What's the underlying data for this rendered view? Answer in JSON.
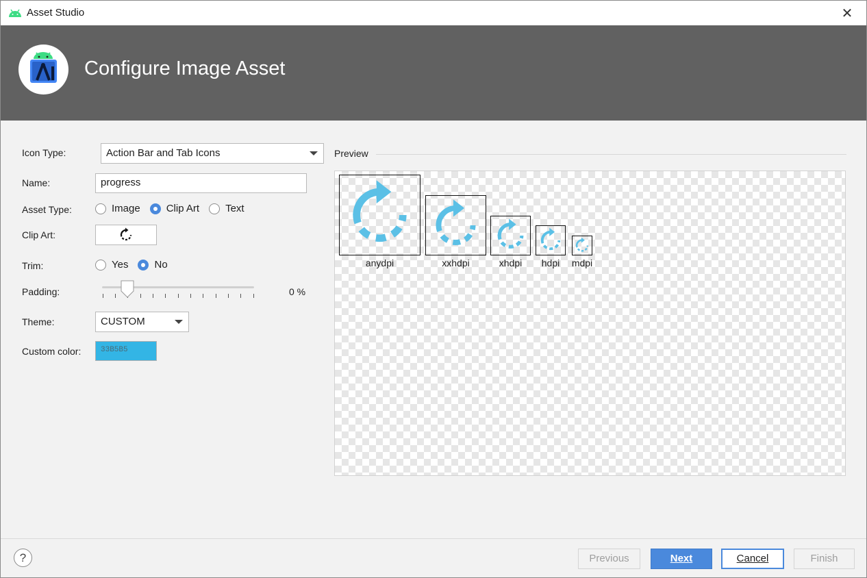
{
  "window": {
    "title": "Asset Studio",
    "close_icon": "close-icon",
    "app_icon": "android-icon"
  },
  "header": {
    "heading": "Configure Image Asset",
    "logo_icon": "android-studio-logo"
  },
  "form": {
    "icon_type": {
      "label": "Icon Type:",
      "value": "Action Bar and Tab Icons"
    },
    "name": {
      "label": "Name:",
      "value": "progress"
    },
    "asset_type": {
      "label": "Asset Type:",
      "options": [
        "Image",
        "Clip Art",
        "Text"
      ],
      "selected": "Clip Art"
    },
    "clip_art": {
      "label": "Clip Art:",
      "icon": "rotate-refresh-icon"
    },
    "trim": {
      "label": "Trim:",
      "options": [
        "Yes",
        "No"
      ],
      "selected": "No"
    },
    "padding": {
      "label": "Padding:",
      "value_text": "0 %",
      "value": 0,
      "range": [
        -10,
        50
      ]
    },
    "theme": {
      "label": "Theme:",
      "value": "CUSTOM"
    },
    "custom_color": {
      "label": "Custom color:",
      "value": "33B5B5",
      "swatch": "#33b5e5"
    }
  },
  "preview": {
    "title": "Preview",
    "icon_color": "#5bc0e6",
    "densities": [
      "anydpi",
      "xxhdpi",
      "xhdpi",
      "hdpi",
      "mdpi"
    ]
  },
  "footer": {
    "help": "?",
    "buttons": {
      "previous": "Previous",
      "next": "Next",
      "cancel": "Cancel",
      "finish": "Finish"
    }
  },
  "colors": {
    "header_bg": "#616161",
    "accent": "#4a89dc",
    "window_bg": "#f2f2f2"
  }
}
